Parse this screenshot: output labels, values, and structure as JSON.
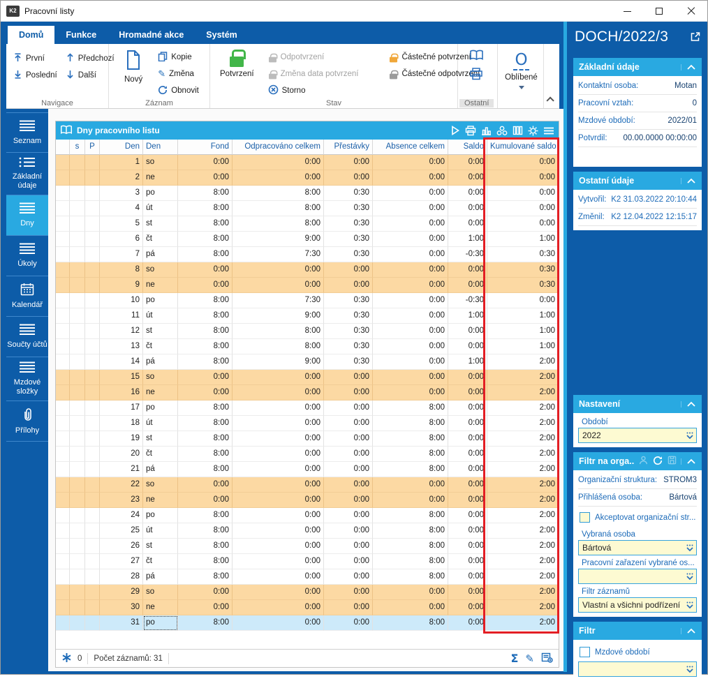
{
  "window": {
    "title": "Pracovní listy",
    "logo": "K2"
  },
  "ribbon": {
    "tabs": [
      {
        "label": "Domů",
        "active": true
      },
      {
        "label": "Funkce",
        "active": false
      },
      {
        "label": "Hromadné akce",
        "active": false
      },
      {
        "label": "Systém",
        "active": false
      }
    ],
    "navigace": {
      "label": "Navigace",
      "first": "První",
      "last": "Poslední",
      "prev": "Předchozí",
      "next": "Další"
    },
    "zaznam": {
      "label": "Záznam",
      "new": "Nový",
      "copy": "Kopie",
      "change": "Změna",
      "refresh": "Obnovit"
    },
    "stav": {
      "label": "Stav",
      "confirm": "Potvrzení",
      "unconfirm": "Odpotvrzení",
      "change_date": "Změna data potvrzení",
      "cancel": "Storno",
      "partial_confirm": "Částečné potvrzení",
      "partial_unconfirm": "Částečné odpotvrzení"
    },
    "ostatni": {
      "label": "Ostatní"
    },
    "oblibene": {
      "label": "Oblíbené",
      "glyph": "O"
    }
  },
  "sidebar": {
    "items": [
      {
        "label": "Seznam",
        "icon": "list",
        "active": false
      },
      {
        "label": "Základní údaje",
        "icon": "list-dots",
        "active": false
      },
      {
        "label": "Dny",
        "icon": "list",
        "active": true
      },
      {
        "label": "Úkoly",
        "icon": "list",
        "active": false
      },
      {
        "label": "Kalendář",
        "icon": "calendar",
        "active": false
      },
      {
        "label": "Součty účtů",
        "icon": "list",
        "active": false
      },
      {
        "label": "Mzdové složky",
        "icon": "list",
        "active": false
      },
      {
        "label": "Přílohy",
        "icon": "paperclip",
        "active": false
      }
    ]
  },
  "grid": {
    "title": "Dny pracovního listu",
    "columns": [
      "",
      "s",
      "P",
      "Den",
      "Den",
      "Fond",
      "Odpracováno celkem",
      "Přestávky",
      "Absence celkem",
      "Saldo",
      "Kumulované saldo"
    ],
    "align": [
      "c",
      "c",
      "c",
      "r",
      "l",
      "r",
      "r",
      "r",
      "r",
      "r",
      "r"
    ],
    "widths": [
      20,
      22,
      21,
      62,
      50,
      78,
      131,
      70,
      108,
      56,
      102
    ],
    "rows": [
      [
        "1",
        "so",
        "0:00",
        "0:00",
        "0:00",
        "0:00",
        "0:00",
        "0:00"
      ],
      [
        "2",
        "ne",
        "0:00",
        "0:00",
        "0:00",
        "0:00",
        "0:00",
        "0:00"
      ],
      [
        "3",
        "po",
        "8:00",
        "8:00",
        "0:30",
        "0:00",
        "0:00",
        "0:00"
      ],
      [
        "4",
        "út",
        "8:00",
        "8:00",
        "0:30",
        "0:00",
        "0:00",
        "0:00"
      ],
      [
        "5",
        "st",
        "8:00",
        "8:00",
        "0:30",
        "0:00",
        "0:00",
        "0:00"
      ],
      [
        "6",
        "čt",
        "8:00",
        "9:00",
        "0:30",
        "0:00",
        "1:00",
        "1:00"
      ],
      [
        "7",
        "pá",
        "8:00",
        "7:30",
        "0:30",
        "0:00",
        "-0:30",
        "0:30"
      ],
      [
        "8",
        "so",
        "0:00",
        "0:00",
        "0:00",
        "0:00",
        "0:00",
        "0:30"
      ],
      [
        "9",
        "ne",
        "0:00",
        "0:00",
        "0:00",
        "0:00",
        "0:00",
        "0:30"
      ],
      [
        "10",
        "po",
        "8:00",
        "7:30",
        "0:30",
        "0:00",
        "-0:30",
        "0:00"
      ],
      [
        "11",
        "út",
        "8:00",
        "9:00",
        "0:30",
        "0:00",
        "1:00",
        "1:00"
      ],
      [
        "12",
        "st",
        "8:00",
        "8:00",
        "0:30",
        "0:00",
        "0:00",
        "1:00"
      ],
      [
        "13",
        "čt",
        "8:00",
        "8:00",
        "0:30",
        "0:00",
        "0:00",
        "1:00"
      ],
      [
        "14",
        "pá",
        "8:00",
        "9:00",
        "0:30",
        "0:00",
        "1:00",
        "2:00"
      ],
      [
        "15",
        "so",
        "0:00",
        "0:00",
        "0:00",
        "0:00",
        "0:00",
        "2:00"
      ],
      [
        "16",
        "ne",
        "0:00",
        "0:00",
        "0:00",
        "0:00",
        "0:00",
        "2:00"
      ],
      [
        "17",
        "po",
        "8:00",
        "0:00",
        "0:00",
        "8:00",
        "0:00",
        "2:00"
      ],
      [
        "18",
        "út",
        "8:00",
        "0:00",
        "0:00",
        "8:00",
        "0:00",
        "2:00"
      ],
      [
        "19",
        "st",
        "8:00",
        "0:00",
        "0:00",
        "8:00",
        "0:00",
        "2:00"
      ],
      [
        "20",
        "čt",
        "8:00",
        "0:00",
        "0:00",
        "8:00",
        "0:00",
        "2:00"
      ],
      [
        "21",
        "pá",
        "8:00",
        "0:00",
        "0:00",
        "8:00",
        "0:00",
        "2:00"
      ],
      [
        "22",
        "so",
        "0:00",
        "0:00",
        "0:00",
        "0:00",
        "0:00",
        "2:00"
      ],
      [
        "23",
        "ne",
        "0:00",
        "0:00",
        "0:00",
        "0:00",
        "0:00",
        "2:00"
      ],
      [
        "24",
        "po",
        "8:00",
        "0:00",
        "0:00",
        "8:00",
        "0:00",
        "2:00"
      ],
      [
        "25",
        "út",
        "8:00",
        "0:00",
        "0:00",
        "8:00",
        "0:00",
        "2:00"
      ],
      [
        "26",
        "st",
        "8:00",
        "0:00",
        "0:00",
        "8:00",
        "0:00",
        "2:00"
      ],
      [
        "27",
        "čt",
        "8:00",
        "0:00",
        "0:00",
        "8:00",
        "0:00",
        "2:00"
      ],
      [
        "28",
        "pá",
        "8:00",
        "0:00",
        "0:00",
        "8:00",
        "0:00",
        "2:00"
      ],
      [
        "29",
        "so",
        "0:00",
        "0:00",
        "0:00",
        "0:00",
        "0:00",
        "2:00"
      ],
      [
        "30",
        "ne",
        "0:00",
        "0:00",
        "0:00",
        "0:00",
        "0:00",
        "2:00"
      ],
      [
        "31",
        "po",
        "8:00",
        "0:00",
        "0:00",
        "8:00",
        "0:00",
        "2:00"
      ]
    ],
    "weekend_days": [
      "so",
      "ne"
    ],
    "selected_day": "31",
    "status": {
      "flag": "0",
      "records": "Počet záznamů: 31"
    }
  },
  "detail": {
    "title": "DOCH/2022/3",
    "basic": {
      "title": "Základní údaje",
      "fields": [
        {
          "label": "Kontaktní osoba:",
          "value": "Motan"
        },
        {
          "label": "Pracovní vztah:",
          "value": "0"
        },
        {
          "label": "Mzdové období:",
          "value": "2022/01"
        },
        {
          "label": "Potvrdil:",
          "value": "00.00.0000 00:00:00"
        }
      ]
    },
    "other": {
      "title": "Ostatní údaje",
      "fields": [
        {
          "label": "Vytvořil:",
          "value": "K2 31.03.2022 20:10:44"
        },
        {
          "label": "Změnil:",
          "value": "K2 12.04.2022 12:15:17"
        }
      ]
    },
    "settings": {
      "title": "Nastavení",
      "period_label": "Období",
      "period_value": "2022"
    },
    "org_filter": {
      "title": "Filtr na orga...",
      "fields": [
        {
          "label": "Organizační struktura:",
          "value": "STROM3"
        },
        {
          "label": "Přihlášená osoba:",
          "value": "Bártová"
        }
      ],
      "checkbox_label": "Akceptovat organizační str...",
      "checkbox_checked": false,
      "selected_person_label": "Vybraná osoba",
      "selected_person_value": "Bártová",
      "job_label": "Pracovní zařazení vybrané os...",
      "job_value": "",
      "records_filter_label": "Filtr záznamů",
      "records_filter_value": "Vlastní a všichni podřízení"
    },
    "filter": {
      "title": "Filtr",
      "checkbox_label": "Mzdové období",
      "checkbox_checked": false,
      "value": ""
    }
  },
  "icons": {
    "sum": "Σ",
    "edit": "✎",
    "change_pencil": "✎"
  },
  "colors": {
    "accent_cyan": "#29a9e1",
    "panel_blue": "#0d5ca8",
    "weekend_row": "#fcd9a3",
    "selected_row": "#cdeafa",
    "highlight_red": "#e31e24",
    "input_yellow": "#fdfad2",
    "lock_green": "#42b649",
    "lock_orange": "#f0a73a"
  }
}
